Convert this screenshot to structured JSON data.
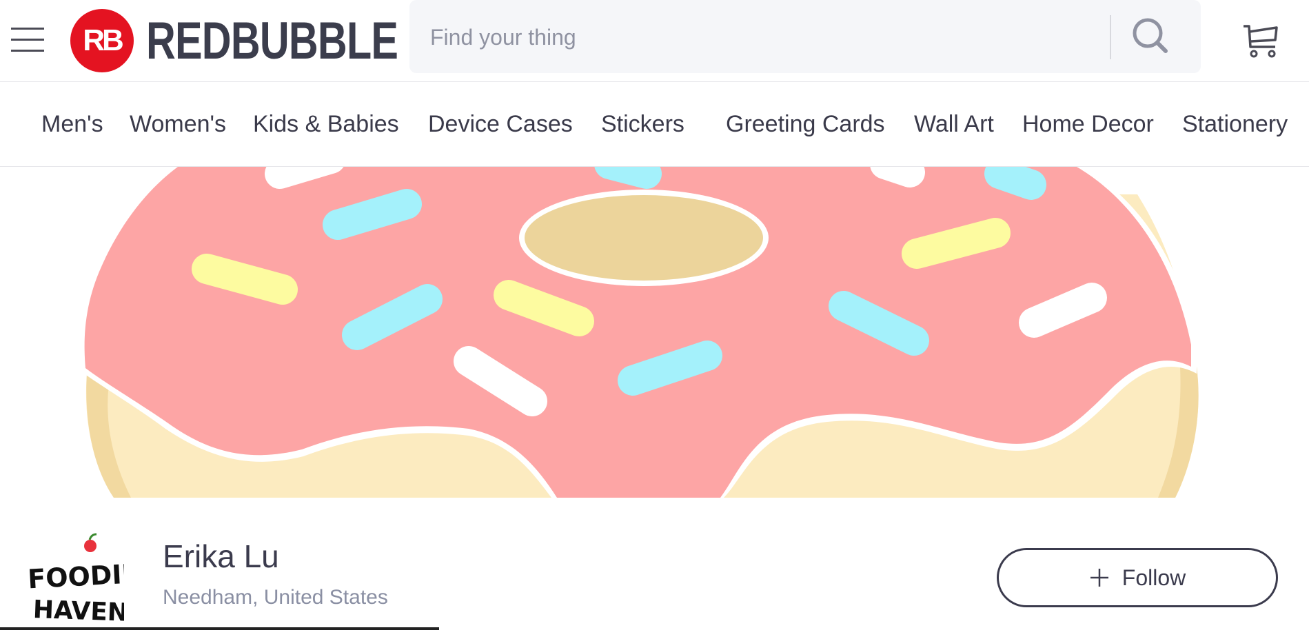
{
  "header": {
    "brand": "REDBUBBLE",
    "logo_mark": "RB",
    "search_placeholder": "Find your thing",
    "icons": {
      "menu": "hamburger-menu-icon",
      "search": "search-icon",
      "cart": "cart-icon"
    }
  },
  "nav": {
    "items": [
      {
        "label": "Men's"
      },
      {
        "label": "Women's"
      },
      {
        "label": "Kids & Babies"
      },
      {
        "label": "Device Cases"
      },
      {
        "label": "Stickers"
      },
      {
        "label": "Greeting Cards"
      },
      {
        "label": "Wall Art"
      },
      {
        "label": "Home Decor"
      },
      {
        "label": "Stationery"
      }
    ]
  },
  "banner": {
    "image": "donut-banner",
    "colors": {
      "frosting": "#fda5a5",
      "dough": "#fcebc0",
      "hole": "#ecd49b",
      "blue": "#a4f1fb",
      "yellow": "#fdfba0",
      "white": "#ffffff"
    }
  },
  "profile": {
    "avatar_text_line1": "FOODIE",
    "avatar_text_line2": "HAVEN",
    "name": "Erika Lu",
    "location": "Needham, United States",
    "follow_label": "Follow"
  },
  "colors": {
    "brand_red": "#e41321",
    "text_dark": "#3b3b4d",
    "text_muted": "#8a8fa3"
  }
}
